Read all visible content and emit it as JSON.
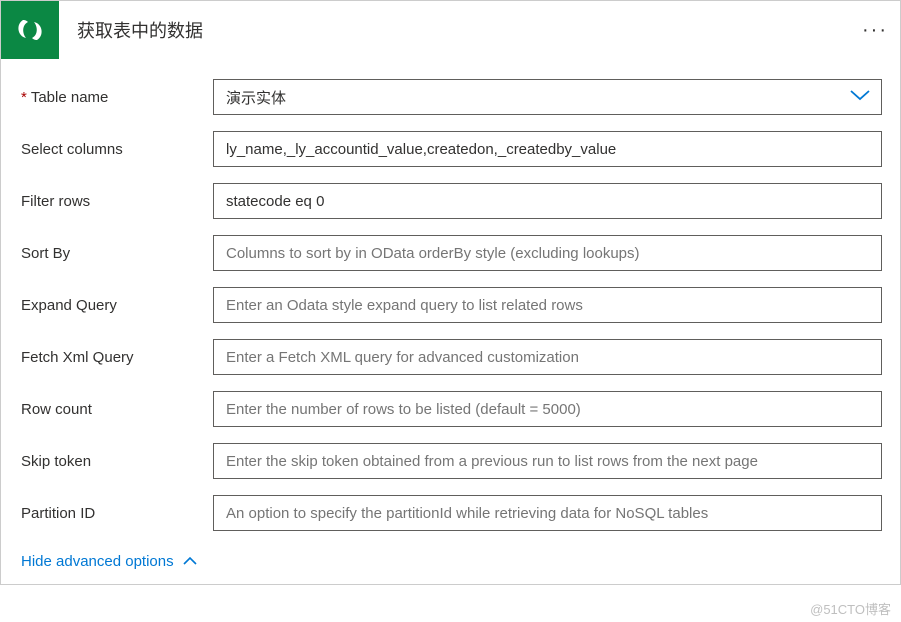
{
  "header": {
    "title": "获取表中的数据",
    "icon": "dataverse-swirl-icon"
  },
  "fields": {
    "tableName": {
      "label": "Table name",
      "required": true,
      "value": "演示实体"
    },
    "selectColumns": {
      "label": "Select columns",
      "value": "ly_name,_ly_accountid_value,createdon,_createdby_value"
    },
    "filterRows": {
      "label": "Filter rows",
      "value": "statecode eq 0"
    },
    "sortBy": {
      "label": "Sort By",
      "placeholder": "Columns to sort by in OData orderBy style (excluding lookups)"
    },
    "expandQuery": {
      "label": "Expand Query",
      "placeholder": "Enter an Odata style expand query to list related rows"
    },
    "fetchXml": {
      "label": "Fetch Xml Query",
      "placeholder": "Enter a Fetch XML query for advanced customization"
    },
    "rowCount": {
      "label": "Row count",
      "placeholder": "Enter the number of rows to be listed (default = 5000)"
    },
    "skipToken": {
      "label": "Skip token",
      "placeholder": "Enter the skip token obtained from a previous run to list rows from the next page"
    },
    "partitionId": {
      "label": "Partition ID",
      "placeholder": "An option to specify the partitionId while retrieving data for NoSQL tables"
    }
  },
  "footer": {
    "hideAdvanced": "Hide advanced options"
  },
  "watermark": "@51CTO博客"
}
